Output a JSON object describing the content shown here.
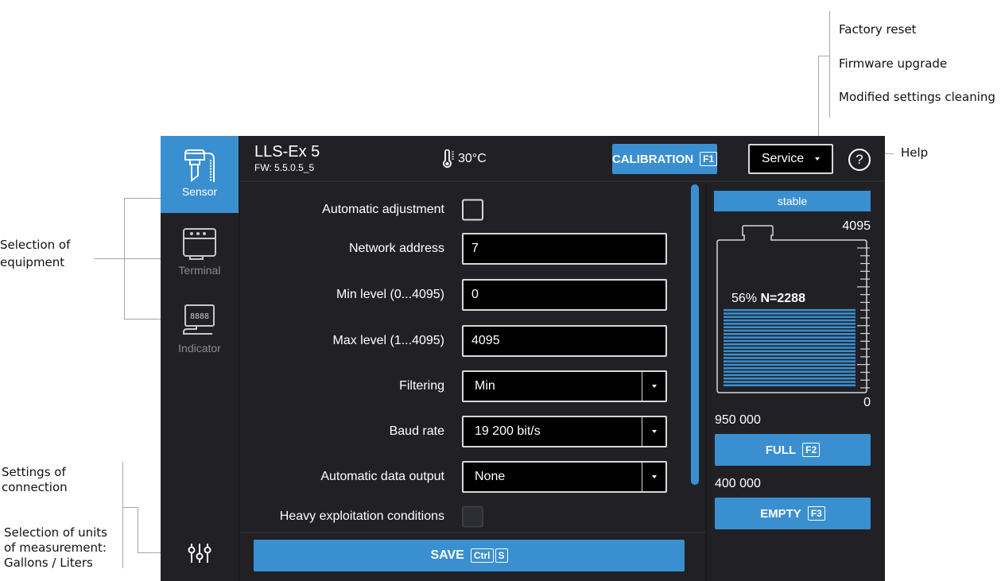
{
  "annotations": {
    "service_menu": [
      "Factory reset",
      "Firmware upgrade",
      "Modified settings cleaning"
    ],
    "help": "Help",
    "equipment": [
      "Selection of",
      "equipment"
    ],
    "connection": [
      "Settings of",
      "connection"
    ],
    "units": [
      "Selection of units",
      "of measurement:",
      "Gallons / Liters"
    ]
  },
  "sidebar": {
    "items": [
      {
        "label": "Sensor",
        "icon": "sensor-icon",
        "active": true
      },
      {
        "label": "Terminal",
        "icon": "terminal-icon",
        "active": false
      },
      {
        "label": "Indicator",
        "icon": "indicator-icon",
        "active": false
      }
    ],
    "settings_icon": "sliders-icon"
  },
  "header": {
    "device_name": "LLS-Ex 5",
    "firmware": "FW: 5.5.0.5_5",
    "temperature": "30°C",
    "calibration_label": "CALIBRATION",
    "calibration_key": "F1",
    "service_label": "Service",
    "help_symbol": "?"
  },
  "form": {
    "automatic_adjustment": {
      "label": "Automatic adjustment",
      "checked": false
    },
    "network_address": {
      "label": "Network address",
      "value": "7"
    },
    "min_level": {
      "label": "Min level (0...4095)",
      "value": "0"
    },
    "max_level": {
      "label": "Max level (1...4095)",
      "value": "4095"
    },
    "filtering": {
      "label": "Filtering",
      "value": "Min"
    },
    "baud_rate": {
      "label": "Baud rate",
      "value": "19 200 bit/s"
    },
    "auto_output": {
      "label": "Automatic data output",
      "value": "None"
    },
    "heavy_conditions": {
      "label": "Heavy exploitation conditions",
      "checked": false
    },
    "save_label": "SAVE",
    "save_keys": [
      "Ctrl",
      "S"
    ]
  },
  "tank": {
    "status": "stable",
    "max_value": "4095",
    "min_value": "0",
    "fill_percent": 56,
    "percent_label": "56%",
    "n_label": "N=2288",
    "full_value": "950 000",
    "full_label": "FULL",
    "full_key": "F2",
    "empty_value": "400 000",
    "empty_label": "EMPTY",
    "empty_key": "F3"
  },
  "colors": {
    "accent": "#3a8fd1",
    "background": "#212125",
    "field": "#000000"
  }
}
